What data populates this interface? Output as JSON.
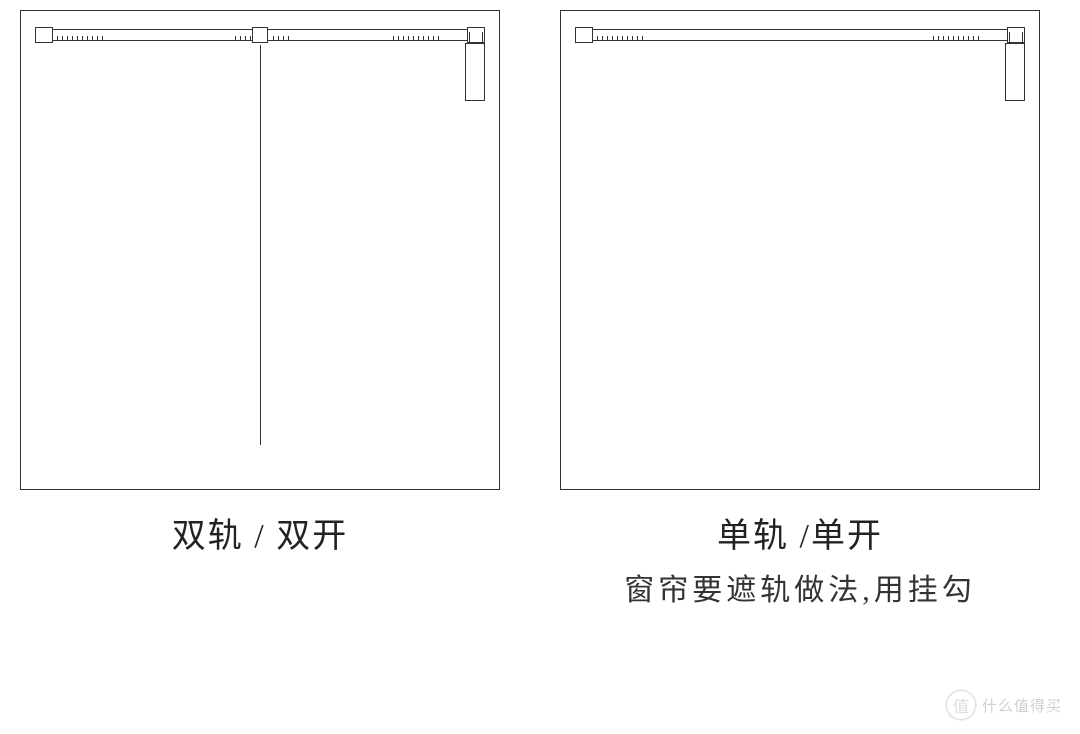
{
  "diagrams": [
    {
      "id": "double",
      "title": "双轨 / 双开",
      "subtitle": "",
      "has_center_divider": true
    },
    {
      "id": "single",
      "title": "单轨 /单开",
      "subtitle": "窗帘要遮轨做法,用挂勾",
      "has_center_divider": false
    }
  ],
  "watermark": {
    "badge_char": "值",
    "text": "什么值得买"
  }
}
